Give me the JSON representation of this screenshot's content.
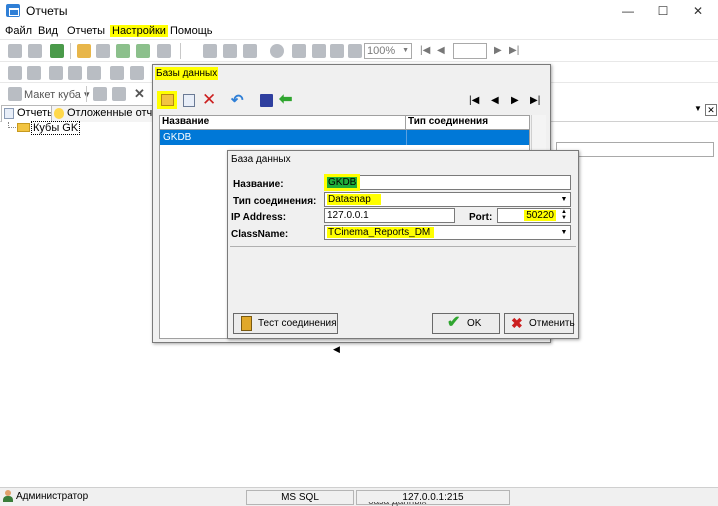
{
  "window": {
    "title": "Отчеты",
    "minimize": "—",
    "maximize": "☐",
    "close": "✕"
  },
  "menu": [
    "Файл",
    "Вид",
    "Отчеты",
    "Настройки",
    "Помощь"
  ],
  "toolbar": {
    "zoom": "100%",
    "cube_layout": "Макет куба",
    "page_number": ""
  },
  "tabs": {
    "reports": "Отчеты",
    "deferred": "Отложенные отчеты"
  },
  "tree": {
    "root": "Кубы GK"
  },
  "db_dialog": {
    "title": "Базы данных",
    "columns": [
      "Название",
      "Тип соединения"
    ],
    "rows": [
      {
        "name": "GKDB",
        "type": ""
      }
    ]
  },
  "edit_dialog": {
    "title": "База данных",
    "name_label": "Название:",
    "name_value": "GKDB",
    "conn_label": "Тип соединения:",
    "conn_value": "Datasnap",
    "ip_label": "IP Address:",
    "ip_value": "127.0.0.1",
    "port_label": "Port:",
    "port_value": "50220",
    "class_label": "ClassName:",
    "class_value": "TCinema_Reports_DM",
    "test_button": "Тест соединения",
    "ok_button": "OK",
    "cancel_button": "Отменить"
  },
  "statusbar": {
    "user": "Администратор",
    "server": "MS SQL",
    "address": "127.0.0.1:215",
    "bottom_fragment": "база данных"
  },
  "colors": {
    "highlight": "#ffff00",
    "selection": "#0078d7",
    "accent_blue": "#2f7fd6",
    "cancel_red": "#cc1f1f",
    "ok_green": "#2fa52f"
  }
}
